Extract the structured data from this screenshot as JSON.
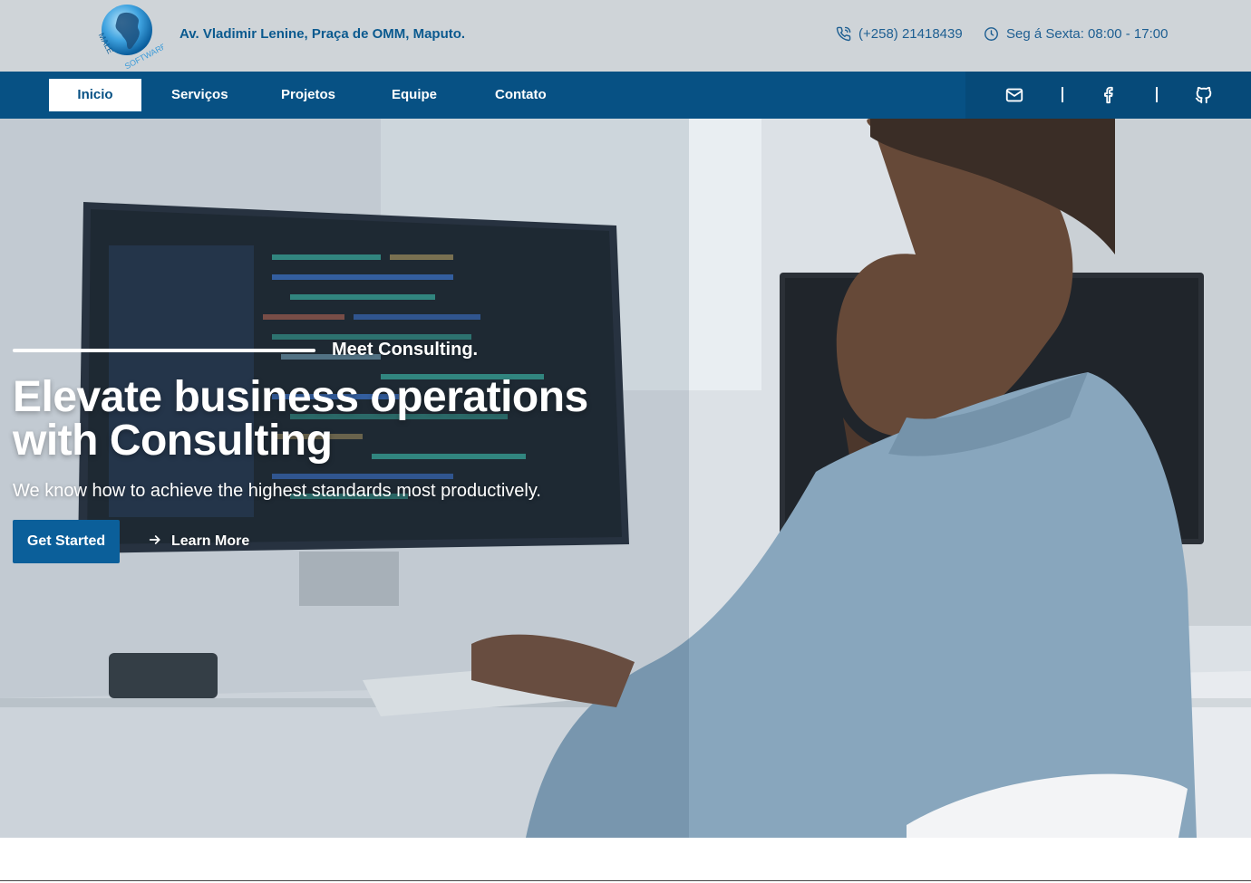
{
  "header": {
    "logo_text": "MALESOFTWARE",
    "address": "Av. Vladimir Lenine, Praça de OMM, Maputo.",
    "phone": "(+258) 21418439",
    "hours": "Seg á Sexta: 08:00 - 17:00"
  },
  "nav": {
    "items": [
      {
        "label": "Inicio",
        "active": true
      },
      {
        "label": "Serviços"
      },
      {
        "label": "Projetos"
      },
      {
        "label": "Equipe"
      },
      {
        "label": "Contato"
      }
    ],
    "social": [
      "mail-icon",
      "facebook-icon",
      "github-icon"
    ]
  },
  "hero": {
    "tagline": "Meet Consulting.",
    "headline_line1": "Elevate business operations",
    "headline_line2": "with Consulting",
    "subhead": "We know how to achieve the highest standards most productively.",
    "primary_button": "Get Started",
    "secondary_button": "Learn More"
  },
  "colors": {
    "brand_blue": "#075184",
    "button_blue": "#0b5f9a",
    "topbar_bg": "#cfd4d8"
  }
}
